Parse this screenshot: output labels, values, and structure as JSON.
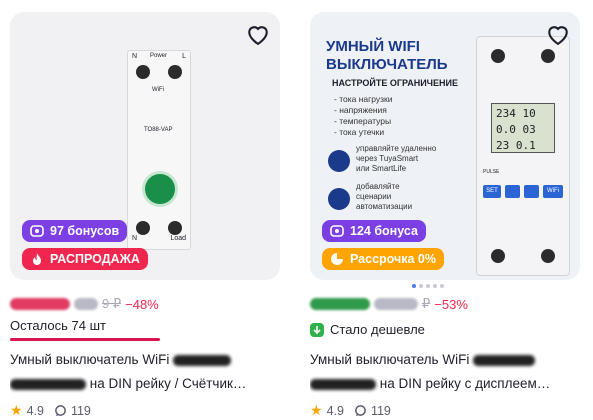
{
  "cards": [
    {
      "bonus_label": "97 бонусов",
      "promo_label": "РАСПРОДАЖА",
      "old_price": "9 ₽",
      "discount": "−48%",
      "stock_text": "Осталось 74 шт",
      "stock_level_percent": 100,
      "title_line1": "Умный выключатель WiFi",
      "title_line2": "на DIN рейку / Счётчик…",
      "rating": "4.9",
      "reviews": "119",
      "art": {
        "top_left": "N",
        "top_right": "L",
        "bottom_left": "N",
        "bottom_right": "Load",
        "label_power": "Power",
        "label_wifi": "WiFi",
        "model": "TO88-VAP"
      }
    },
    {
      "bonus_label": "124 бонуса",
      "promo_label": "Рассрочка 0%",
      "old_price": "₽",
      "discount": "−53%",
      "cheaper_text": "Стало дешевле",
      "title_line1": "Умный выключатель WiFi",
      "title_line2": "на DIN рейку с дисплеем…",
      "rating": "4.9",
      "reviews": "119",
      "art": {
        "headline_1": "УМНЫЙ WIFI",
        "headline_2": "ВЫКЛЮЧАТЕЛЬ",
        "subhead": "НАСТРОЙТЕ ОГРАНИЧЕНИЕ",
        "limits": [
          "- тока нагрузки",
          "- напряжения",
          "- температуры",
          "- тока утечки"
        ],
        "feature_1": [
          "управляйте удаленно",
          "через TuyaSmart",
          "или SmartLife"
        ],
        "feature_2": [
          "добавляйте",
          "сценарии",
          "автоматизации"
        ],
        "lcd_line_1": "234 10",
        "lcd_line_2": "0.0 03",
        "lcd_line_3": "23 0.1",
        "set_label": "SET",
        "wifi_label": "WiFi",
        "pulse_label": "PULSE"
      }
    }
  ],
  "carousel": {
    "dot_count": 5,
    "active_index": 0
  },
  "colors": {
    "bonus": "#7b3fe4",
    "sale": "#f1264f",
    "installment": "#ffa400",
    "discount": "#f1264f",
    "star": "#ffa400",
    "cheaper": "#2fb24c"
  },
  "icons": {
    "favorite": "heart-icon",
    "bonus": "bonus-icon",
    "sale": "fire-icon",
    "installment": "installment-icon",
    "cheaper": "down-arrow-icon",
    "rating": "star-icon",
    "reviews": "comment-icon"
  }
}
